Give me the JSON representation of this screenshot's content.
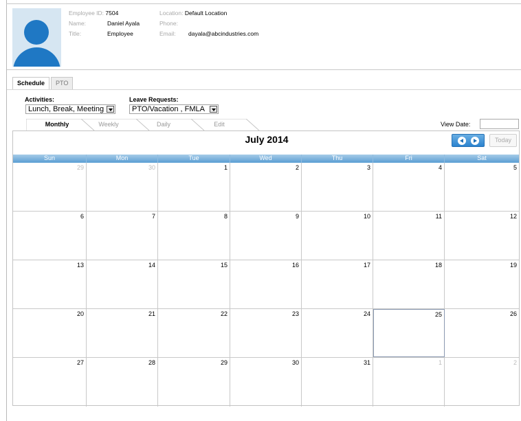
{
  "employee": {
    "id_label": "Employee ID:",
    "id": "7504",
    "name_label": "Name:",
    "name": "Daniel Ayala",
    "title_label": "Title:",
    "title": "Employee",
    "location_label": "Location:",
    "location": "Default Location",
    "phone_label": "Phone:",
    "phone": "",
    "email_label": "Email:",
    "email": "dayala@abcindustries.com"
  },
  "tabs": {
    "schedule": "Schedule",
    "pto": "PTO"
  },
  "filters": {
    "activities_label": "Activities:",
    "activities_value": "Lunch, Break, Meeting",
    "leave_label": "Leave Requests:",
    "leave_value": "PTO/Vacation , FMLA"
  },
  "views": {
    "monthly": "Monthly",
    "weekly": "Weekly",
    "daily": "Daily",
    "edit": "Edit"
  },
  "view_date_label": "View Date:",
  "calendar": {
    "title": "July 2014",
    "today_label": "Today",
    "days": [
      "Sun",
      "Mon",
      "Tue",
      "Wed",
      "Thu",
      "Fri",
      "Sat"
    ],
    "weeks": [
      [
        {
          "d": "29",
          "o": true
        },
        {
          "d": "30",
          "o": true
        },
        {
          "d": "1"
        },
        {
          "d": "2"
        },
        {
          "d": "3"
        },
        {
          "d": "4"
        },
        {
          "d": "5"
        }
      ],
      [
        {
          "d": "6"
        },
        {
          "d": "7"
        },
        {
          "d": "8"
        },
        {
          "d": "9"
        },
        {
          "d": "10"
        },
        {
          "d": "11"
        },
        {
          "d": "12"
        }
      ],
      [
        {
          "d": "13"
        },
        {
          "d": "14"
        },
        {
          "d": "15"
        },
        {
          "d": "16"
        },
        {
          "d": "17"
        },
        {
          "d": "18"
        },
        {
          "d": "19"
        }
      ],
      [
        {
          "d": "20"
        },
        {
          "d": "21"
        },
        {
          "d": "22"
        },
        {
          "d": "23"
        },
        {
          "d": "24"
        },
        {
          "d": "25",
          "today": true
        },
        {
          "d": "26"
        }
      ],
      [
        {
          "d": "27"
        },
        {
          "d": "28"
        },
        {
          "d": "29"
        },
        {
          "d": "30"
        },
        {
          "d": "31"
        },
        {
          "d": "1",
          "o": true
        },
        {
          "d": "2",
          "o": true
        }
      ]
    ]
  },
  "colors": {
    "accent": "#1f78c4",
    "header_bar": "#5a9ed3"
  }
}
